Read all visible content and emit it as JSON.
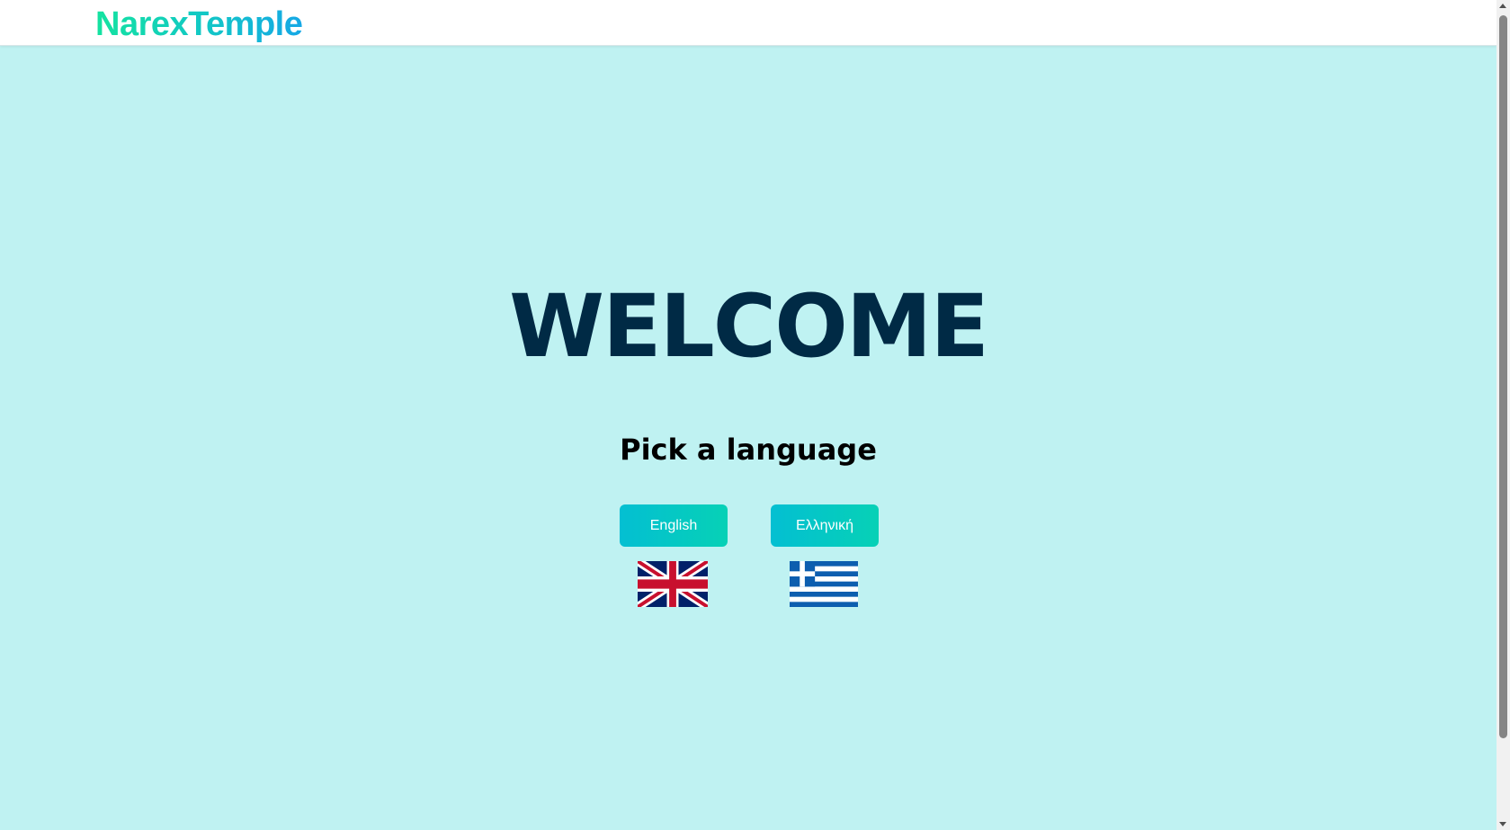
{
  "header": {
    "logo_text": "NarexTemple"
  },
  "main": {
    "heading": "WELCOME",
    "subtitle": "Pick a language",
    "languages": [
      {
        "label": "English",
        "flag": "uk-flag-icon"
      },
      {
        "label": "Ελληνική",
        "flag": "greece-flag-icon"
      }
    ]
  },
  "colors": {
    "background": "#bff2f2",
    "heading": "#002a45",
    "button_gradient_start": "#04bfd2",
    "button_gradient_end": "#06d1b6",
    "logo_gradient_start": "#14e3a0",
    "logo_gradient_end": "#16a8e6"
  }
}
